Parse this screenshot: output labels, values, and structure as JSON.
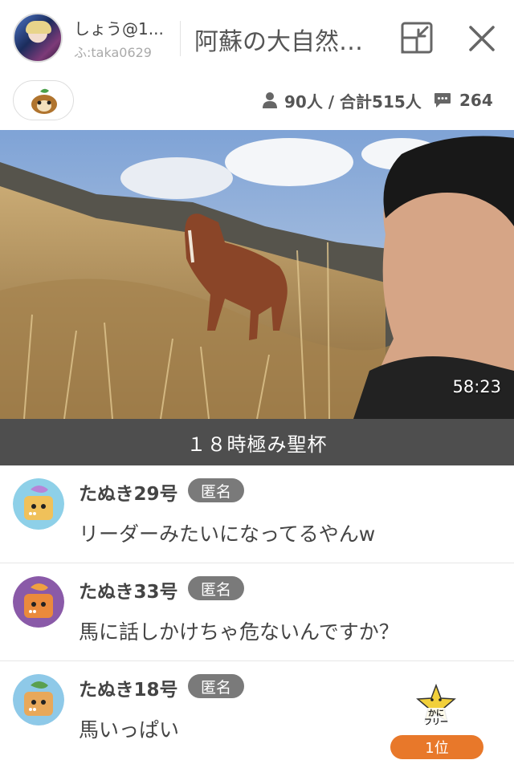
{
  "header": {
    "user_name": "しょう@1...",
    "user_id": "ふ:taka0629",
    "room_title": "阿蘇の大自然…"
  },
  "stats": {
    "listeners": "90人 / 合計515人",
    "comment_count": "264"
  },
  "video": {
    "elapsed_time": "58:23",
    "theme": "１８時極み聖杯"
  },
  "comments": [
    {
      "name": "たぬき29号",
      "badge": "匿名",
      "text": "リーダーみたいになってるやんw",
      "avatar_color": "#f0c15a"
    },
    {
      "name": "たぬき33号",
      "badge": "匿名",
      "text": "馬に話しかけちゃ危ないんですか？",
      "avatar_color": "#ea8a3c"
    },
    {
      "name": "たぬき18号",
      "badge": "匿名",
      "text": "馬いっぱい",
      "avatar_color": "#8ec9e8"
    }
  ],
  "rank": {
    "star_label": "かに\nフリー",
    "position": "1位"
  },
  "colors": {
    "accent": "#e8782a",
    "theme_bar": "#4e4e4e",
    "badge": "#7a7a7a"
  }
}
